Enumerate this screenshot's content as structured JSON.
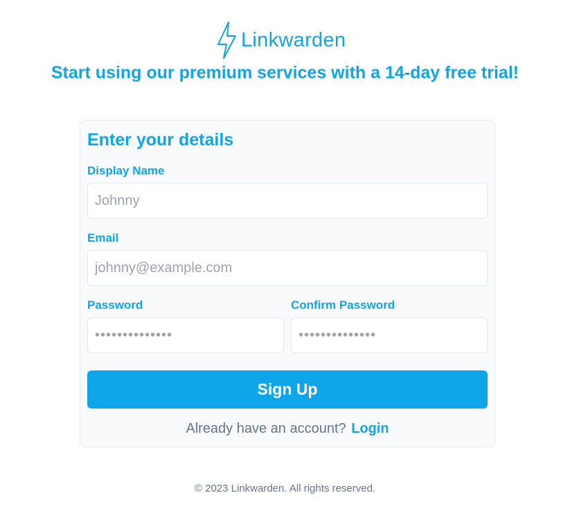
{
  "brand": {
    "name": "Linkwarden",
    "icon": "lightning-bolt-icon",
    "color": "#0ea5e9"
  },
  "headline": "Start using our premium services with a 14-day free trial!",
  "form": {
    "title": "Enter your details",
    "display_name": {
      "label": "Display Name",
      "placeholder": "Johnny",
      "value": ""
    },
    "email": {
      "label": "Email",
      "placeholder": "johnny@example.com",
      "value": ""
    },
    "password": {
      "label": "Password",
      "placeholder": "••••••••••••••",
      "value": ""
    },
    "confirm_password": {
      "label": "Confirm Password",
      "placeholder": "••••••••••••••",
      "value": ""
    },
    "submit_label": "Sign Up",
    "login_prompt": "Already have an account?",
    "login_link": "Login"
  },
  "footer": "© 2023 Linkwarden. All rights reserved."
}
